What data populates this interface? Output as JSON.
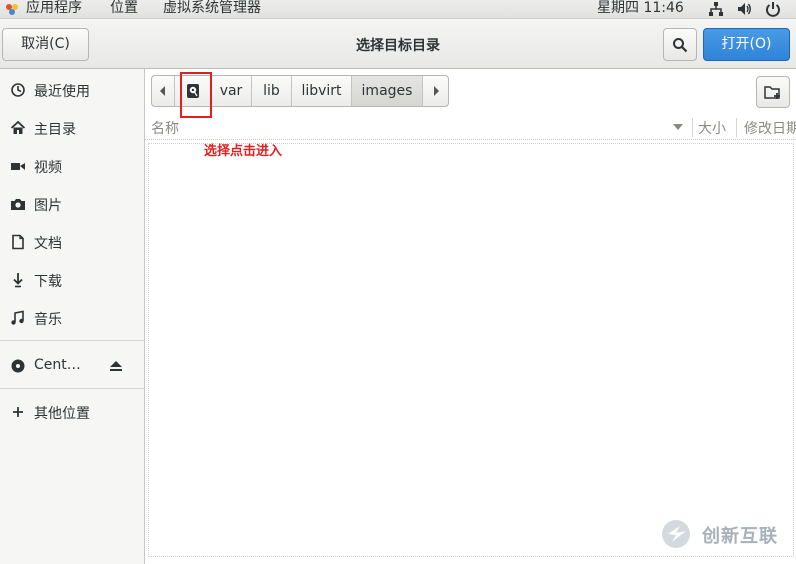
{
  "topbar": {
    "applications": "应用程序",
    "places": "位置",
    "app_name": "虚拟系统管理器",
    "clock": "星期四 11:46"
  },
  "header": {
    "cancel_label": "取消(C)",
    "title": "选择目标目录",
    "open_label": "打开(O)"
  },
  "sidebar": {
    "items": [
      {
        "label": "最近使用",
        "icon": "recent-icon"
      },
      {
        "label": "主目录",
        "icon": "home-icon"
      },
      {
        "label": "视频",
        "icon": "video-icon"
      },
      {
        "label": "图片",
        "icon": "camera-icon"
      },
      {
        "label": "文档",
        "icon": "document-icon"
      },
      {
        "label": "下载",
        "icon": "download-icon"
      },
      {
        "label": "音乐",
        "icon": "music-icon"
      }
    ],
    "device": {
      "label": "Cent…",
      "icon": "disc-icon"
    },
    "other_locations": "其他位置"
  },
  "pathbar": {
    "segments": [
      "var",
      "lib",
      "libvirt",
      "images"
    ],
    "active": "images"
  },
  "columns": {
    "name": "名称",
    "size": "大小",
    "modified": "修改日期"
  },
  "annotation": {
    "text": "选择点击进入",
    "color": "#e02020"
  },
  "watermark": {
    "text": "创新互联"
  },
  "colors": {
    "accent": "#2f84d8",
    "annotation": "#e02020"
  }
}
